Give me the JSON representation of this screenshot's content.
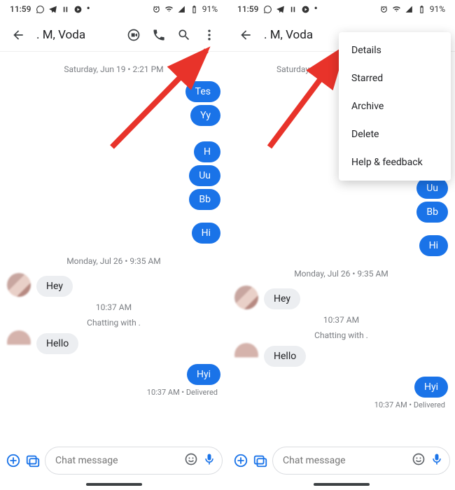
{
  "status": {
    "time": "11:59",
    "battery": "91%"
  },
  "header": {
    "title": ". M, Voda"
  },
  "dates": {
    "d1": "Saturday, Jun 19 • 2:21 PM",
    "d2": "Monday, Jul 26 • 9:35 AM"
  },
  "sys": {
    "t1": "10:37 AM",
    "t2": "Chatting with ."
  },
  "msg": {
    "o1": "Tes",
    "o2": "Yy",
    "o3": "H",
    "o4": "Uu",
    "o5": "Bb",
    "o6": "Hi",
    "i1": "Hey",
    "i2": "Hello",
    "o7": "Hyi"
  },
  "sub": {
    "s1": "10:37 AM • Delivered"
  },
  "composer": {
    "placeholder": "Chat message"
  },
  "menu": {
    "m1": "Details",
    "m2": "Starred",
    "m3": "Archive",
    "m4": "Delete",
    "m5": "Help & feedback"
  }
}
